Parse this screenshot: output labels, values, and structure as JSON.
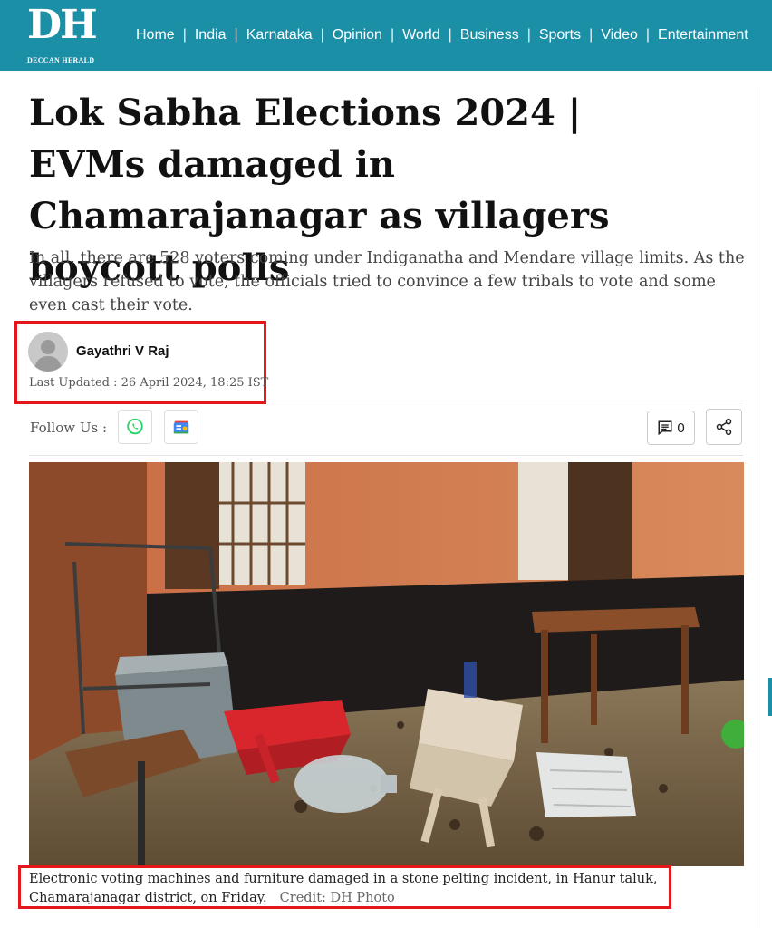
{
  "header": {
    "logo_mark": "DH",
    "logo_sub": "DECCAN HERALD",
    "nav": [
      "Home",
      "India",
      "Karnataka",
      "Opinion",
      "World",
      "Business",
      "Sports",
      "Video",
      "Entertainment"
    ],
    "brand_color": "#1b8fa6"
  },
  "article": {
    "title": "Lok Sabha Elections 2024 | EVMs damaged in Chamarajanagar as villagers boycott polls",
    "summary": "In all, there are 528 voters coming under Indiganatha and Mendare village limits. As the villagers refused to vote, the officials tried to convince a few tribals to vote and some even cast their vote.",
    "author": "Gayathri V Raj",
    "updated": "Last Updated : 26 April 2024, 18:25 IST",
    "follow_label": "Follow Us :",
    "comment_count": "0",
    "caption": "Electronic voting machines and furniture damaged in a stone pelting incident, in Hanur taluk, Chamarajanagar district, on Friday.",
    "credit": "Credit: DH Photo"
  },
  "icons": {
    "whatsapp": "whatsapp-icon",
    "google_news": "google-news-icon",
    "comment": "comment-icon",
    "share": "share-icon",
    "avatar": "avatar-placeholder-icon"
  },
  "highlight_color": "#e4181c"
}
